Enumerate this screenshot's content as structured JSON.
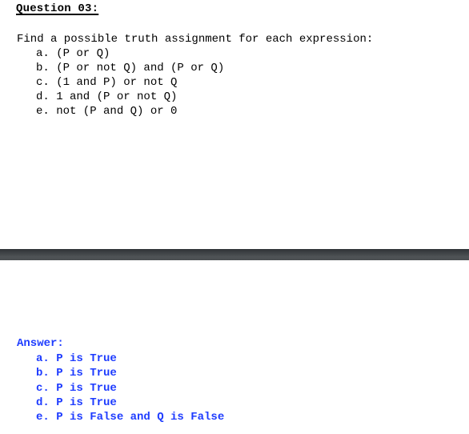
{
  "question": {
    "title": "Question 03:",
    "prompt": "Find a possible truth assignment for each expression:",
    "expressions": [
      "a. (P or Q)",
      "b. (P or not Q) and (P or Q)",
      "c. (1 and P) or not Q",
      "d. 1 and (P or not Q)",
      "e. not (P and Q) or 0"
    ]
  },
  "answer": {
    "title": "Answer:",
    "items": [
      "a. P is True",
      "b. P is True",
      "c. P is True",
      "d. P is True",
      "e. P is False and Q is False"
    ],
    "color": "#1e3cff"
  }
}
